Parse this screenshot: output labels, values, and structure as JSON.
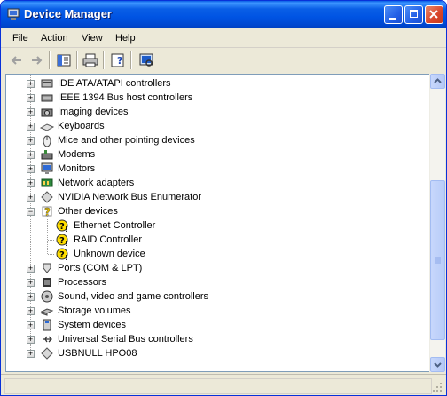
{
  "window": {
    "title": "Device Manager"
  },
  "menu": [
    "File",
    "Action",
    "View",
    "Help"
  ],
  "tree": [
    {
      "label": "IDE ATA/ATAPI controllers",
      "icon": "ide-controller-icon",
      "expanded": false
    },
    {
      "label": "IEEE 1394 Bus host controllers",
      "icon": "firewire-controller-icon",
      "expanded": false
    },
    {
      "label": "Imaging devices",
      "icon": "camera-icon",
      "expanded": false
    },
    {
      "label": "Keyboards",
      "icon": "keyboard-icon",
      "expanded": false
    },
    {
      "label": "Mice and other pointing devices",
      "icon": "mouse-icon",
      "expanded": false
    },
    {
      "label": "Modems",
      "icon": "modem-icon",
      "expanded": false
    },
    {
      "label": "Monitors",
      "icon": "monitor-icon",
      "expanded": false
    },
    {
      "label": "Network adapters",
      "icon": "network-adapter-icon",
      "expanded": false
    },
    {
      "label": "NVIDIA Network Bus Enumerator",
      "icon": "diamond-device-icon",
      "expanded": false
    },
    {
      "label": "Other devices",
      "icon": "question-device-icon",
      "expanded": true,
      "children": [
        {
          "label": "Ethernet Controller",
          "icon": "warning-device-icon"
        },
        {
          "label": "RAID Controller",
          "icon": "warning-device-icon"
        },
        {
          "label": "Unknown device",
          "icon": "warning-device-icon"
        }
      ]
    },
    {
      "label": "Ports (COM & LPT)",
      "icon": "port-icon",
      "expanded": false
    },
    {
      "label": "Processors",
      "icon": "processor-icon",
      "expanded": false
    },
    {
      "label": "Sound, video and game controllers",
      "icon": "sound-icon",
      "expanded": false
    },
    {
      "label": "Storage volumes",
      "icon": "storage-icon",
      "expanded": false
    },
    {
      "label": "System devices",
      "icon": "computer-icon",
      "expanded": false
    },
    {
      "label": "Universal Serial Bus controllers",
      "icon": "usb-icon",
      "expanded": false
    },
    {
      "label": "USBNULL HPO08",
      "icon": "diamond-device-icon",
      "expanded": false
    }
  ],
  "colors": {
    "titlebar": "#0054e3",
    "accent": "#316ac5",
    "warning": "#ffde00"
  }
}
